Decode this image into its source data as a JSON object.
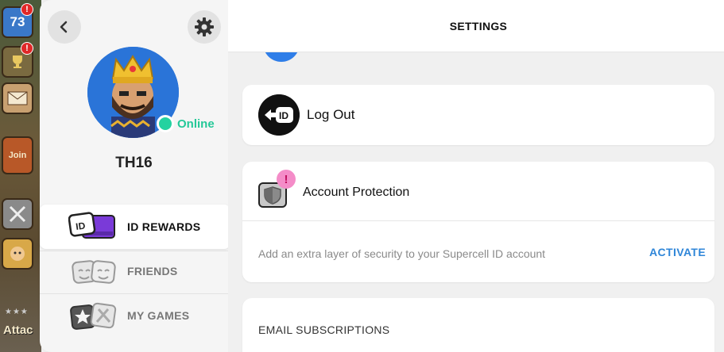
{
  "game_sidebar": {
    "level_value": "73",
    "level_badge": "!",
    "trophy_badge": "!",
    "join_label": "Join",
    "attack_label": "Attac"
  },
  "profile": {
    "player_name": "TH16",
    "status": "Online",
    "status_color": "#24d2a0",
    "nav": [
      {
        "label": "ID REWARDS",
        "icon": "id-rewards-icon",
        "active": true
      },
      {
        "label": "FRIENDS",
        "icon": "friends-icon",
        "active": false
      },
      {
        "label": "MY GAMES",
        "icon": "my-games-icon",
        "active": false
      }
    ]
  },
  "header": {
    "title": "SETTINGS"
  },
  "logout": {
    "icon_text": "ID",
    "label": "Log Out"
  },
  "account_protection": {
    "label": "Account Protection",
    "badge": "!",
    "description": "Add an extra layer of security to your Supercell ID account",
    "action": "ACTIVATE",
    "action_color": "#2f86d8"
  },
  "email_subscriptions": {
    "label": "EMAIL SUBSCRIPTIONS"
  }
}
